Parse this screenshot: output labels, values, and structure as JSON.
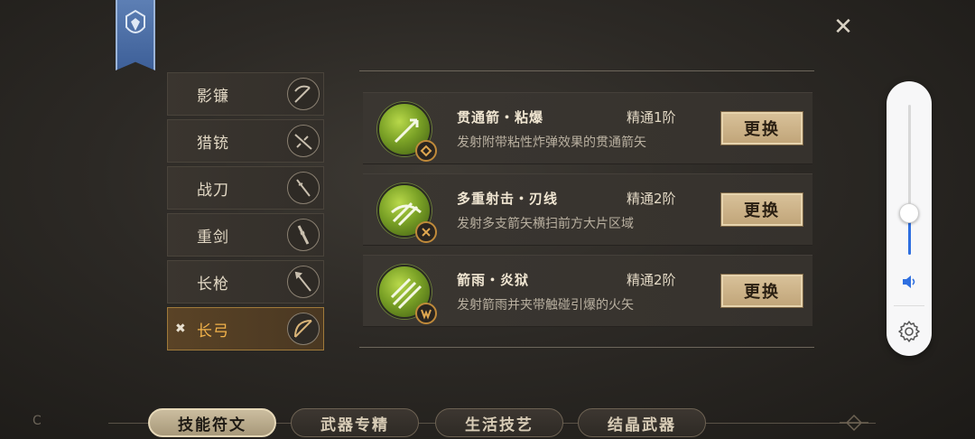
{
  "window": {
    "close_label": "✕"
  },
  "weapons": [
    {
      "label": "影镰",
      "icon": "scythe-icon",
      "active": false
    },
    {
      "label": "猎铳",
      "icon": "gun-icon",
      "active": false
    },
    {
      "label": "战刀",
      "icon": "sword-icon",
      "active": false
    },
    {
      "label": "重剑",
      "icon": "greatsword-icon",
      "active": false
    },
    {
      "label": "长枪",
      "icon": "spear-icon",
      "active": false
    },
    {
      "label": "长弓",
      "icon": "bow-icon",
      "active": true
    }
  ],
  "skills": [
    {
      "name": "贯通箭・粘爆",
      "level": "精通1阶",
      "desc": "发射附带粘性炸弹效果的贯通箭矢",
      "button": "更换"
    },
    {
      "name": "多重射击・刃线",
      "level": "精通2阶",
      "desc": "发射多支箭矢横扫前方大片区域",
      "button": "更换"
    },
    {
      "name": "箭雨・炎狱",
      "level": "精通2阶",
      "desc": "发射箭雨并夹带触碰引爆的火矢",
      "button": "更换"
    }
  ],
  "tabs": [
    {
      "label": "技能符文",
      "active": true
    },
    {
      "label": "武器专精",
      "active": false
    },
    {
      "label": "生活技艺",
      "active": false
    },
    {
      "label": "结晶武器",
      "active": false
    }
  ],
  "volume": {
    "level": 0.28
  },
  "colors": {
    "accent": "#f2b24a",
    "skill_green": "#7aa126",
    "volume_blue": "#2f6fe0"
  },
  "footer": {
    "text": "C"
  }
}
